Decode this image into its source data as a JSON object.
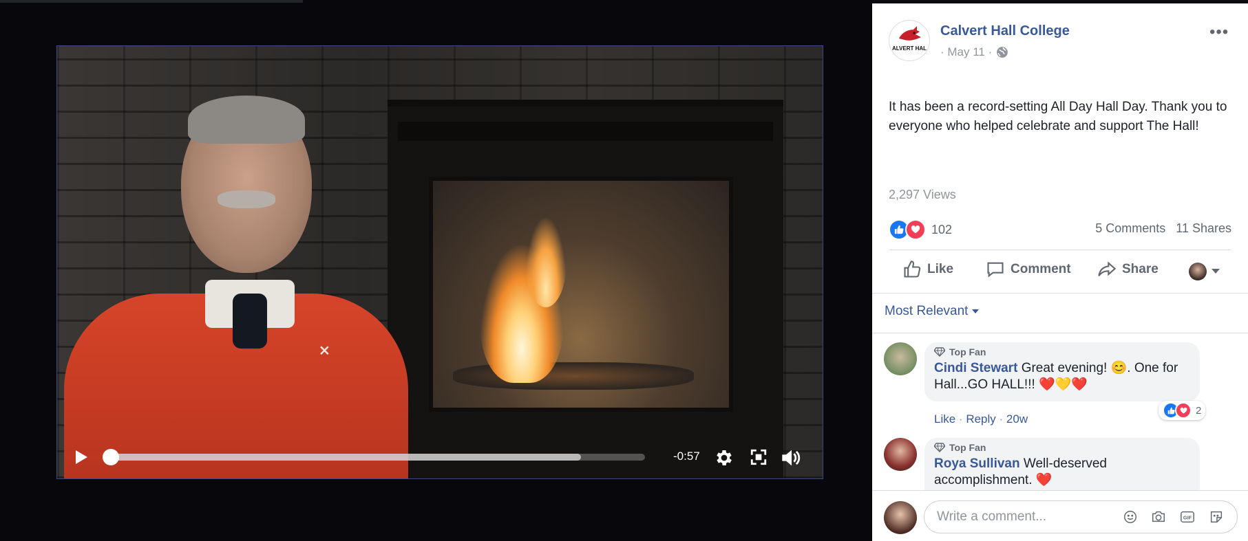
{
  "video": {
    "time_remaining": "-0:57",
    "progress_fraction": 0.0,
    "buffered_fraction": 0.88
  },
  "post": {
    "page_name": "Calvert Hall College",
    "page_avatar_text": "ALVERT HAL",
    "date": "· May 11 ·",
    "text": "It has been a record-setting All Day Hall Day. Thank you to everyone who helped celebrate and support The Hall!",
    "views": "2,297 Views",
    "reaction_count": "102",
    "comments_count": "5 Comments",
    "shares_count": "11 Shares"
  },
  "actions": {
    "like": "Like",
    "comment": "Comment",
    "share": "Share"
  },
  "comments_sort": "Most Relevant",
  "comments": [
    {
      "badge": "Top Fan",
      "author": "Cindi Stewart",
      "text": "Great evening! 😊. One for Hall...GO HALL!!! ❤️💛❤️",
      "like": "Like",
      "reply": "Reply",
      "age": "20w",
      "reactions": "2"
    },
    {
      "badge": "Top Fan",
      "author": "Roya Sullivan",
      "text": "Well-deserved accomplishment. ❤️"
    }
  ],
  "composer": {
    "placeholder": "Write a comment..."
  },
  "colors": {
    "link": "#385898",
    "like_blue": "#1877f2",
    "love_red": "#f33e58"
  }
}
